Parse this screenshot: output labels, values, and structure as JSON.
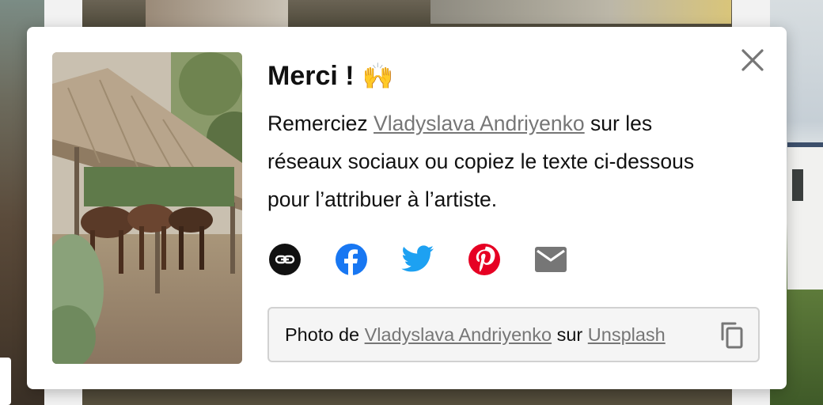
{
  "modal": {
    "title": "Merci !",
    "title_emoji": "🙌",
    "message_before": "Remerciez ",
    "artist_name": "Vladyslava Andriyenko",
    "message_after": " sur les réseaux sociaux ou copiez le texte ci-dessous pour l’attribuer à l’artiste.",
    "close_icon": "close-icon",
    "share": {
      "items": [
        {
          "name": "copy-link",
          "icon": "link-icon",
          "color": "#111111"
        },
        {
          "name": "facebook",
          "icon": "facebook-icon",
          "color": "#1877f2"
        },
        {
          "name": "twitter",
          "icon": "twitter-icon",
          "color": "#1da1f2"
        },
        {
          "name": "pinterest",
          "icon": "pinterest-icon",
          "color": "#e60023"
        },
        {
          "name": "email",
          "icon": "email-icon",
          "color": "#767676"
        }
      ]
    },
    "attribution": {
      "prefix": "Photo de ",
      "artist_name": "Vladyslava Andriyenko",
      "middle": " sur ",
      "site": "Unsplash",
      "copy_icon": "copy-icon"
    }
  },
  "colors": {
    "link": "#767676",
    "text": "#111111",
    "field_bg": "#f5f5f5",
    "field_border": "#d1d1d1"
  }
}
